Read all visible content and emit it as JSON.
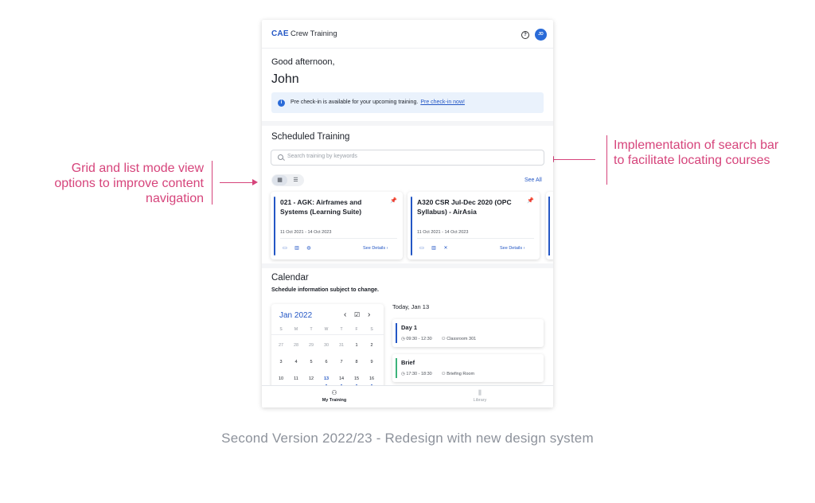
{
  "header": {
    "logo": "CAE",
    "title": "Crew Training",
    "help_icon": "?",
    "avatar_initials": "JD"
  },
  "greeting": {
    "line1": "Good afternoon,",
    "name": "John"
  },
  "notice": {
    "text": "Pre check-in is available for your upcoming training.",
    "link": "Pre check-in now!"
  },
  "scheduled": {
    "title": "Scheduled Training",
    "search_placeholder": "Search training by keywords",
    "see_all": "See All",
    "view_modes": {
      "grid_icon": "▦",
      "list_icon": "☰"
    },
    "cards": [
      {
        "title": "021 - AGK: Airframes and Systems (Learning Suite)",
        "dates": "11 Oct 2021 - 14 Oct 2023",
        "details": "See Details  ›",
        "pin": "📌",
        "icons": [
          "▭",
          "▥",
          "◍"
        ]
      },
      {
        "title": "A320 CSR Jul-Dec 2020 (OPC Syllabus) - AirAsia",
        "dates": "11 Oct 2021 - 14 Oct 2023",
        "details": "See Details  ›",
        "pin": "📌",
        "icons": [
          "▭",
          "▥",
          "✕"
        ]
      }
    ]
  },
  "calendar": {
    "title": "Calendar",
    "subtitle": "Schedule information subject to change.",
    "month": "Jan 2022",
    "weekdays": [
      "S",
      "M",
      "T",
      "W",
      "T",
      "F",
      "S"
    ],
    "weeks": [
      [
        "27",
        "28",
        "29",
        "30",
        "31",
        "1",
        "2"
      ],
      [
        "3",
        "4",
        "5",
        "6",
        "7",
        "8",
        "9"
      ],
      [
        "10",
        "11",
        "12",
        "13",
        "14",
        "15",
        "16"
      ]
    ],
    "today_label": "Today,  Jan 13",
    "events": [
      {
        "title": "Day 1",
        "time": "09:30 - 12:30",
        "room": "Classroom 301",
        "color": "#2457c5"
      },
      {
        "title": "Brief",
        "time": "17:30 - 18:30",
        "room": "Briefing Room",
        "color": "#3cb37a"
      }
    ]
  },
  "bottom_nav": [
    {
      "label": "My Training",
      "icon": "⚇"
    },
    {
      "label": "Library",
      "icon": "⫼"
    }
  ],
  "annotations": {
    "left": "Grid and list mode view options to improve content navigation",
    "right": "Implementation of search bar to facilitate locating courses"
  },
  "caption": "Second Version 2022/23 - Redesign with new design system"
}
